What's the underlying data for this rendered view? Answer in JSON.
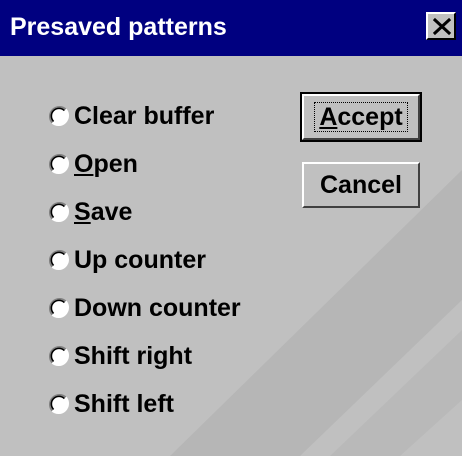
{
  "window": {
    "title": "Presaved patterns",
    "close_symbol": "×",
    "title_bar_color": "#000080",
    "face_color": "#c0c0c0"
  },
  "options": [
    {
      "mnemonic": "",
      "rest": "Clear buffer",
      "selected": false
    },
    {
      "mnemonic": "O",
      "rest": "pen",
      "selected": false
    },
    {
      "mnemonic": "S",
      "rest": "ave",
      "selected": false
    },
    {
      "mnemonic": "",
      "rest": "Up counter",
      "selected": false
    },
    {
      "mnemonic": "",
      "rest": "Down counter",
      "selected": false
    },
    {
      "mnemonic": "",
      "rest": "Shift right",
      "selected": false
    },
    {
      "mnemonic": "",
      "rest": "Shift left",
      "selected": false
    }
  ],
  "buttons": {
    "accept": {
      "mnemonic": "A",
      "rest": "ccept"
    },
    "cancel": {
      "label": "Cancel"
    }
  }
}
